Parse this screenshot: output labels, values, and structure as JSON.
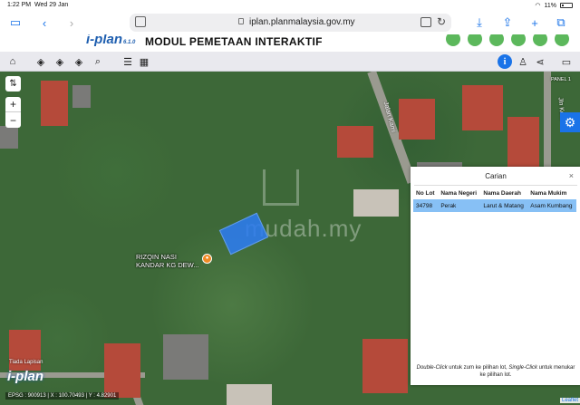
{
  "status_bar": {
    "time": "1:22 PM",
    "date": "Wed 29 Jan",
    "battery": "11%"
  },
  "browser": {
    "url": "iplan.planmalaysia.gov.my"
  },
  "header": {
    "logo": "i-plan",
    "logo_suffix": "6.1.0",
    "title": "MODUL PEMETAAN INTERAKTIF"
  },
  "map": {
    "poi_label_1": "RIZQIN NASI",
    "poi_label_2": "KANDAR KG DEW...",
    "road_label_1": "Jalan Kami",
    "road_label_2": "Jln Kota",
    "panel_label": "PANEL 1",
    "layer_status": "Tiada Lapisan",
    "map_logo": "i-plan",
    "coords": "EPSG : 900913 | X : 100.70493 | Y : 4.82901",
    "attribution": "Leaflet",
    "watermark": "mudah.my"
  },
  "carian": {
    "title": "Carian",
    "close": "×",
    "headers": [
      "No Lot",
      "Nama Negeri",
      "Nama Daerah",
      "Nama Mukim"
    ],
    "rows": [
      [
        "34798",
        "Perak",
        "Larut & Matang",
        "Asam Kumbang"
      ]
    ],
    "foot_part1": "Double-Click",
    "foot_part2": " untuk zum ke pilihan lot, ",
    "foot_part3": "Single-Click",
    "foot_part4": " untuk menukar ke pilihan lot."
  },
  "colors": {
    "accent": "#1a73e8",
    "parcel": "#2d7cf0",
    "row_highlight": "#87c0f5"
  }
}
